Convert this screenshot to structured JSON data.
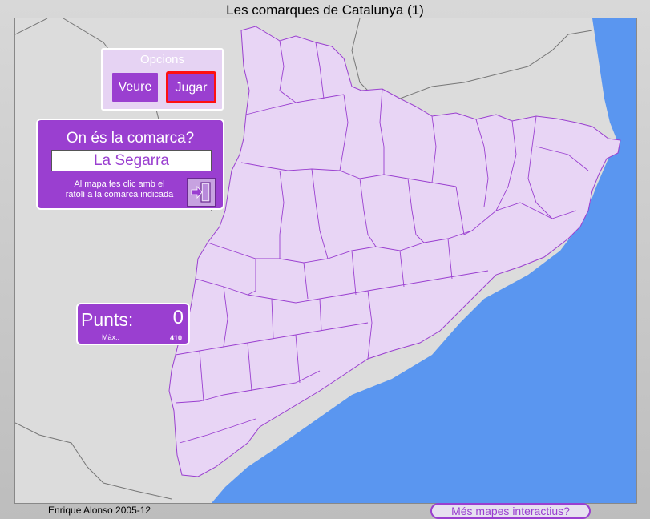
{
  "title": "Les comarques de Catalunya (1)",
  "options": {
    "label": "Opcions",
    "view": "Veure",
    "play": "Jugar"
  },
  "question": {
    "prompt": "On és la comarca?",
    "target": "La Segarra",
    "help_line1": "Al mapa fes clic amb el",
    "help_line2": "ratolí a la comarca indicada",
    "exit_icon": "exit-door-icon"
  },
  "score": {
    "label": "Punts:",
    "value": "0",
    "max_label": "Màx.:",
    "max_value": "410"
  },
  "footer": {
    "author": "Enrique Alonso 2005-12",
    "more_maps": "Més mapes interactius?"
  },
  "colors": {
    "land": "#e8d5f5",
    "sea": "#5a96f0",
    "accent": "#9a3fd0",
    "highlight": "#ff1010"
  }
}
